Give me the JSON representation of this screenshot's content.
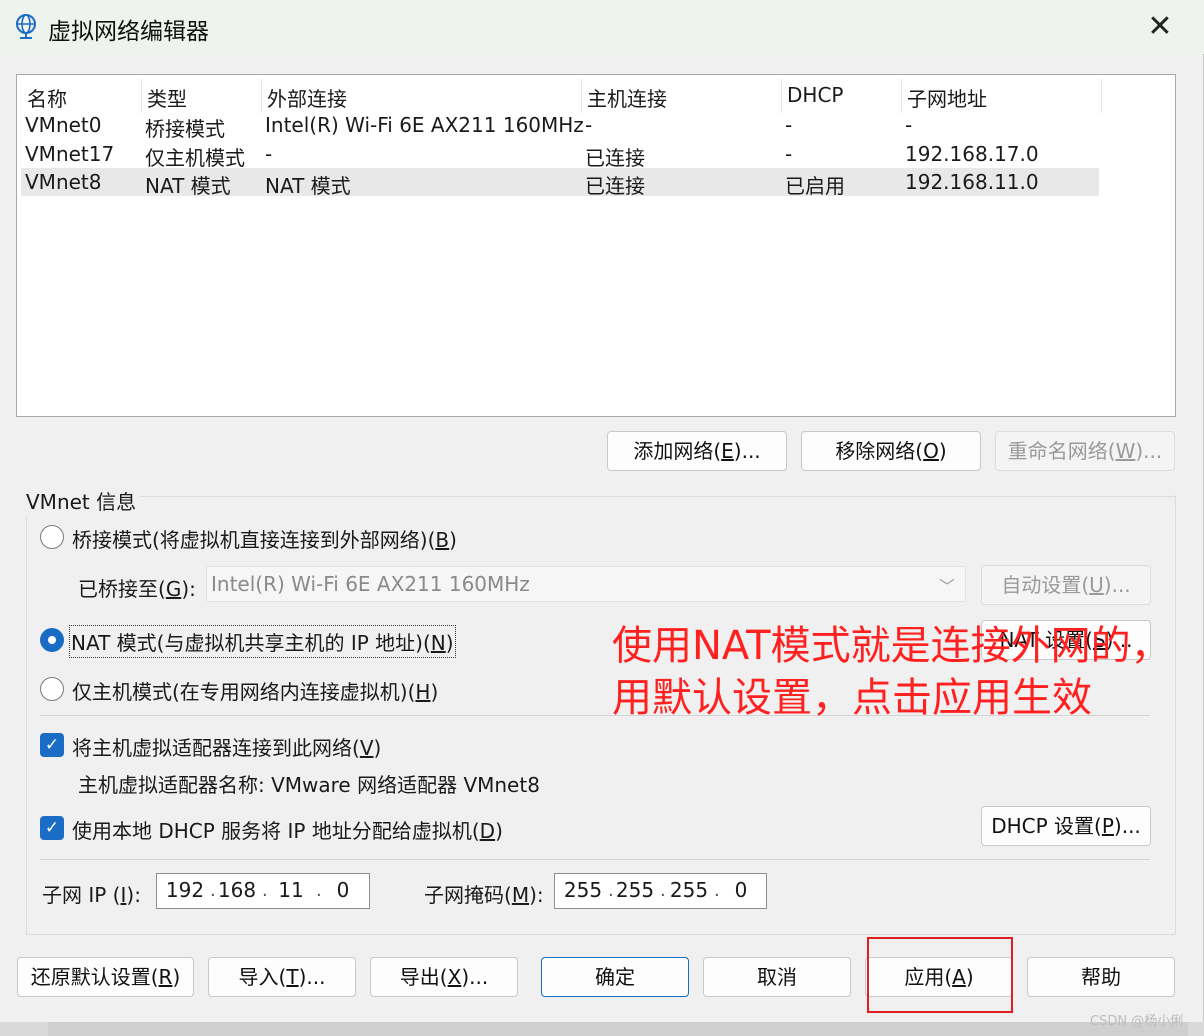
{
  "window": {
    "title": "虚拟网络编辑器",
    "close_glyph": "✕"
  },
  "table": {
    "headers": [
      "名称",
      "类型",
      "外部连接",
      "主机连接",
      "DHCP",
      "子网地址"
    ],
    "rows": [
      [
        "VMnet0",
        "桥接模式",
        "Intel(R) Wi-Fi 6E AX211 160MHz",
        "-",
        "-",
        "-"
      ],
      [
        "VMnet17",
        "仅主机模式",
        "-",
        "已连接",
        "-",
        "192.168.17.0"
      ],
      [
        "VMnet8",
        "NAT 模式",
        "NAT 模式",
        "已连接",
        "已启用",
        "192.168.11.0"
      ]
    ],
    "selected_row": 2
  },
  "network_buttons": {
    "add": {
      "text": "添加网络(",
      "key": "E",
      "suffix": ")..."
    },
    "remove": {
      "text": "移除网络(",
      "key": "O",
      "suffix": ")"
    },
    "rename": {
      "text": "重命名网络(",
      "key": "W",
      "suffix": ")..."
    }
  },
  "vmnet_info": {
    "group_label": "VMnet 信息",
    "bridged": {
      "text": "桥接模式(将虚拟机直接连接到外部网络)(",
      "key": "B",
      "suffix": ")",
      "checked": false
    },
    "bridged_to": {
      "text": "已桥接至(",
      "key": "G",
      "suffix": "):"
    },
    "bridged_adapter": "Intel(R) Wi-Fi 6E AX211 160MHz",
    "auto_settings": {
      "text": "自动设置(",
      "key": "U",
      "suffix": ")..."
    },
    "nat": {
      "text": "NAT 模式(与虚拟机共享主机的 IP 地址)(",
      "key": "N",
      "suffix": ")",
      "checked": true
    },
    "nat_settings": {
      "text": "NAT 设置(",
      "key": "S",
      "suffix": ")..."
    },
    "host_only": {
      "text": "仅主机模式(在专用网络内连接虚拟机)(",
      "key": "H",
      "suffix": ")",
      "checked": false
    },
    "connect_adapter": {
      "text": "将主机虚拟适配器连接到此网络(",
      "key": "V",
      "suffix": ")",
      "checked": true
    },
    "adapter_name": "主机虚拟适配器名称: VMware 网络适配器 VMnet8",
    "use_dhcp": {
      "text": "使用本地 DHCP 服务将 IP 地址分配给虚拟机(",
      "key": "D",
      "suffix": ")",
      "checked": true
    },
    "dhcp_settings": {
      "text": "DHCP 设置(",
      "key": "P",
      "suffix": ")..."
    },
    "subnet_ip_label": {
      "text": "子网 IP (",
      "key": "I",
      "suffix": "):"
    },
    "subnet_ip": [
      "192",
      "168",
      "11",
      "0"
    ],
    "subnet_mask_label": {
      "text": "子网掩码(",
      "key": "M",
      "suffix": "):"
    },
    "subnet_mask": [
      "255",
      "255",
      "255",
      "0"
    ]
  },
  "footer_buttons": {
    "restore": {
      "text": "还原默认设置(",
      "key": "R",
      "suffix": ")"
    },
    "import": {
      "text": "导入(",
      "key": "T",
      "suffix": ")..."
    },
    "export": {
      "text": "导出(",
      "key": "X",
      "suffix": ")..."
    },
    "ok": "确定",
    "cancel": "取消",
    "apply": {
      "text": "应用(",
      "key": "A",
      "suffix": ")"
    },
    "help": "帮助"
  },
  "annotation": {
    "line1": "使用NAT模式就是连接外网的，",
    "line2": "用默认设置，点击应用生效",
    "color": "#ff2020"
  },
  "watermark": "CSDN @杨小俐",
  "colors": {
    "accent": "#1a6cc4",
    "highlight_box": "#e02020"
  }
}
